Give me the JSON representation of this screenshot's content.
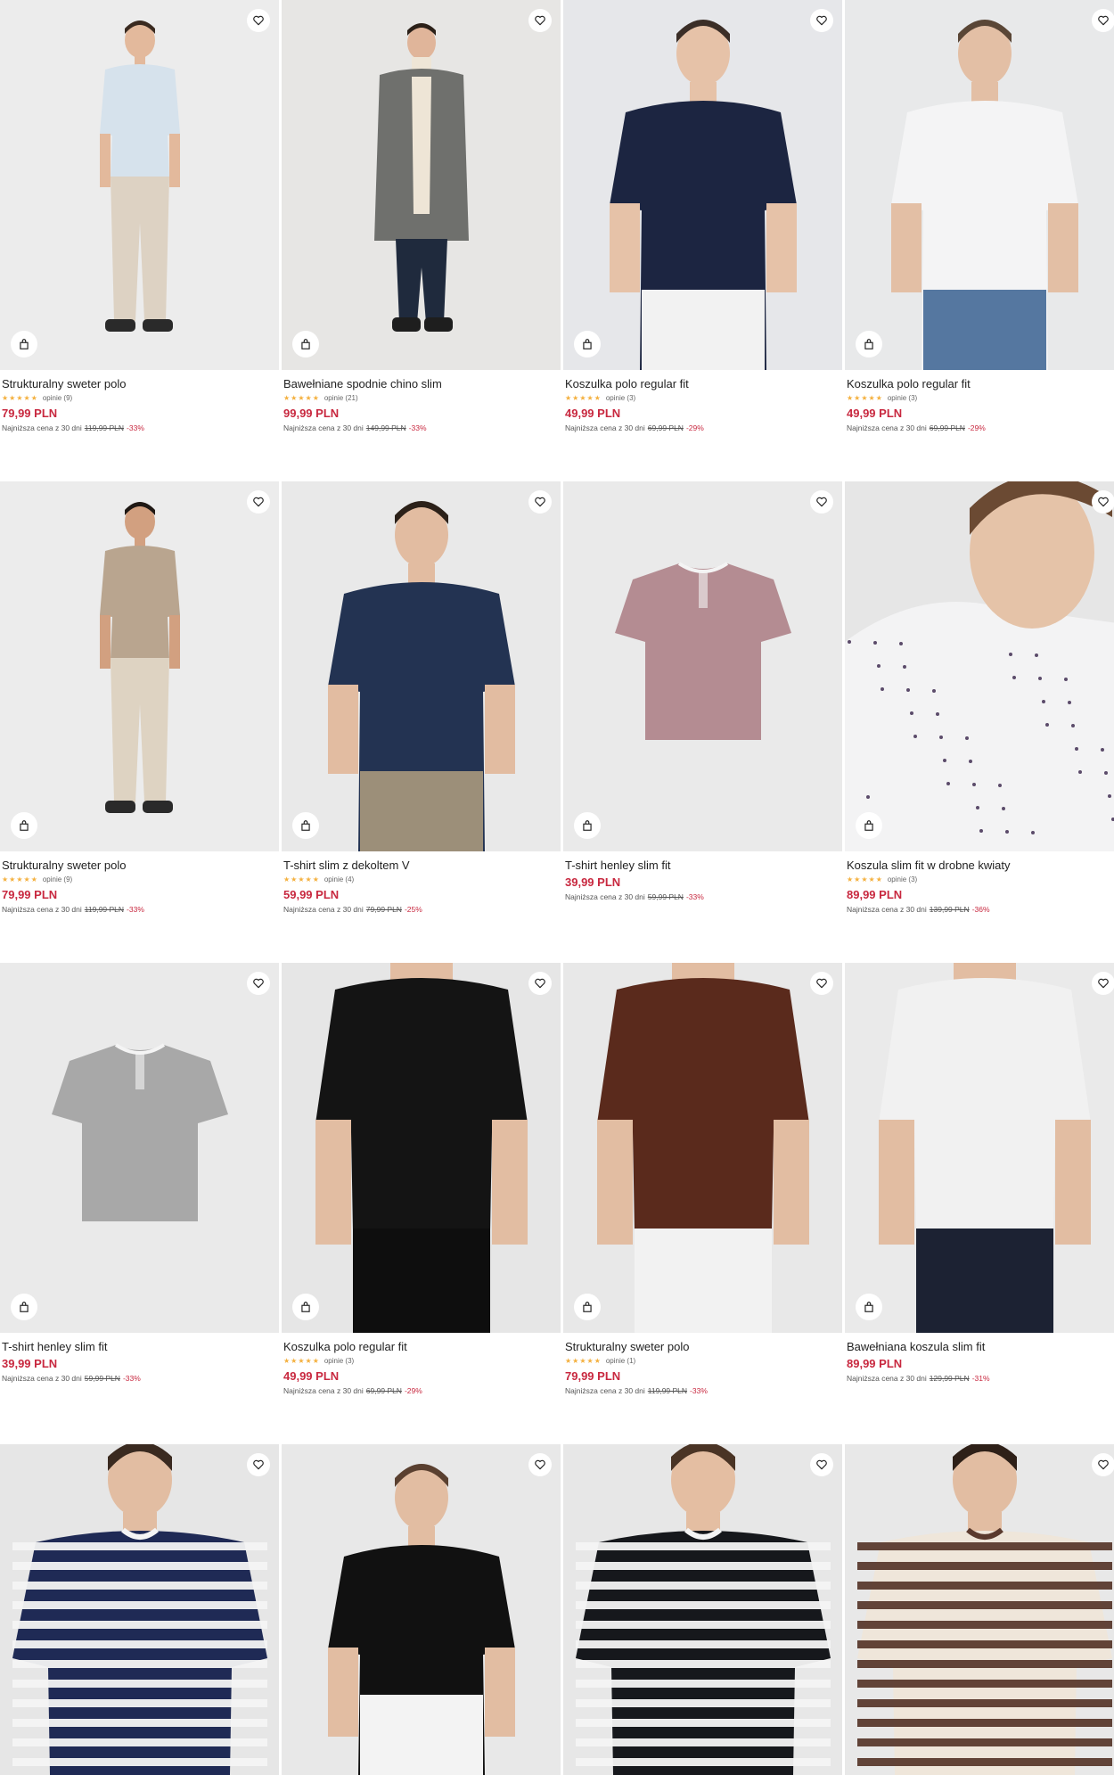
{
  "labels": {
    "lowest_prefix": "Najniższa cena z 30 dni",
    "stars": "★★★★★"
  },
  "rows": [
    [
      {
        "name": "Strukturalny sweter polo",
        "reviews": "opinie (9)",
        "price": "79,99 PLN",
        "old_price": "119,99 PLN",
        "discount": "-33%",
        "image": "man-light-blue-polo-beige-trousers"
      },
      {
        "name": "Bawełniane spodnie chino slim",
        "reviews": "opinie (21)",
        "price": "99,99 PLN",
        "old_price": "149,99 PLN",
        "discount": "-33%",
        "image": "man-grey-coat-navy-chinos"
      },
      {
        "name": "Koszulka polo regular fit",
        "reviews": "opinie (3)",
        "price": "49,99 PLN",
        "old_price": "69,99 PLN",
        "discount": "-29%",
        "image": "man-navy-printed-polo"
      },
      {
        "name": "Koszulka polo regular fit",
        "reviews": "opinie (3)",
        "price": "49,99 PLN",
        "old_price": "69,99 PLN",
        "discount": "-29%",
        "image": "man-white-printed-polo"
      }
    ],
    [
      {
        "name": "Strukturalny sweter polo",
        "reviews": "opinie (9)",
        "price": "79,99 PLN",
        "old_price": "119,99 PLN",
        "discount": "-33%",
        "image": "man-beige-polo-trousers"
      },
      {
        "name": "T-shirt slim z dekoltem V",
        "reviews": "opinie (4)",
        "price": "59,99 PLN",
        "old_price": "79,99 PLN",
        "discount": "-25%",
        "image": "man-navy-vneck-tshirt"
      },
      {
        "name": "T-shirt henley slim fit",
        "reviews": "",
        "price": "39,99 PLN",
        "old_price": "59,99 PLN",
        "discount": "-33%",
        "image": "burgundy-henley-flatlay"
      },
      {
        "name": "Koszula slim fit w drobne kwiaty",
        "reviews": "opinie (3)",
        "price": "89,99 PLN",
        "old_price": "139,99 PLN",
        "discount": "-36%",
        "image": "man-white-floral-shirt-closeup"
      }
    ],
    [
      {
        "name": "T-shirt henley slim fit",
        "reviews": "",
        "price": "39,99 PLN",
        "old_price": "59,99 PLN",
        "discount": "-33%",
        "image": "grey-henley-flatlay"
      },
      {
        "name": "Koszulka polo regular fit",
        "reviews": "opinie (3)",
        "price": "49,99 PLN",
        "old_price": "69,99 PLN",
        "discount": "-29%",
        "image": "man-black-printed-polo"
      },
      {
        "name": "Strukturalny sweter polo",
        "reviews": "opinie (1)",
        "price": "79,99 PLN",
        "old_price": "119,99 PLN",
        "discount": "-33%",
        "image": "man-brown-knit-polo"
      },
      {
        "name": "Bawełniana koszula slim fit",
        "reviews": "",
        "price": "89,99 PLN",
        "old_price": "129,99 PLN",
        "discount": "-31%",
        "image": "man-white-patterned-shirt"
      }
    ],
    [
      {
        "name": "",
        "reviews": "",
        "price": "",
        "old_price": "",
        "discount": "",
        "image": "man-navy-white-striped-tshirt"
      },
      {
        "name": "",
        "reviews": "",
        "price": "",
        "old_price": "",
        "discount": "",
        "image": "man-black-tshirt"
      },
      {
        "name": "",
        "reviews": "",
        "price": "",
        "old_price": "",
        "discount": "",
        "image": "man-black-white-striped-tshirt"
      },
      {
        "name": "",
        "reviews": "",
        "price": "",
        "old_price": "",
        "discount": "",
        "image": "man-beige-striped-tshirt"
      }
    ]
  ],
  "colors": {
    "accent_price": "#c8283f",
    "stars": "#f4b03e",
    "photo_bg": "#eeeeee"
  }
}
